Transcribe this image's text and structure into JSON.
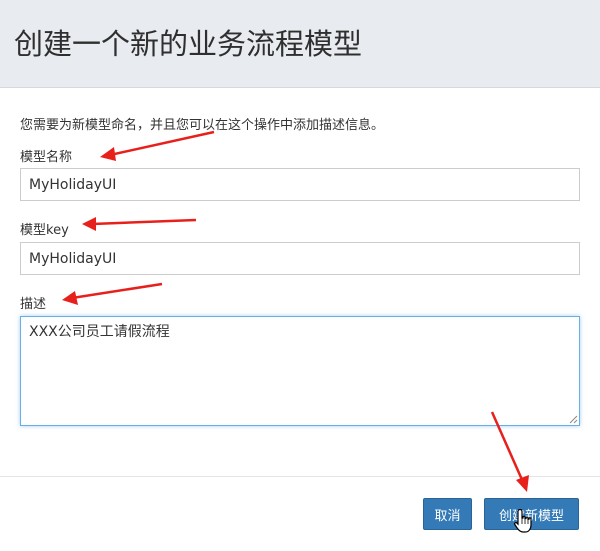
{
  "dialog": {
    "title": "创建一个新的业务流程模型",
    "description": "您需要为新模型命名，并且您可以在这个操作中添加描述信息。"
  },
  "form": {
    "name_label": "模型名称",
    "name_value": "MyHolidayUI",
    "key_label": "模型key",
    "key_value": "MyHolidayUI",
    "desc_label": "描述",
    "desc_value": "XXX公司员工请假流程"
  },
  "footer": {
    "cancel_label": "取消",
    "create_label": "创建新模型"
  },
  "colors": {
    "header_bg": "#e8ebef",
    "primary_button": "#337ab7",
    "focus_border": "#66afe9",
    "annotation_arrow": "#e8201c"
  },
  "icons": [
    "hand-pointer-cursor-icon",
    "resize-grip-icon",
    "annotation-arrow-icon"
  ]
}
